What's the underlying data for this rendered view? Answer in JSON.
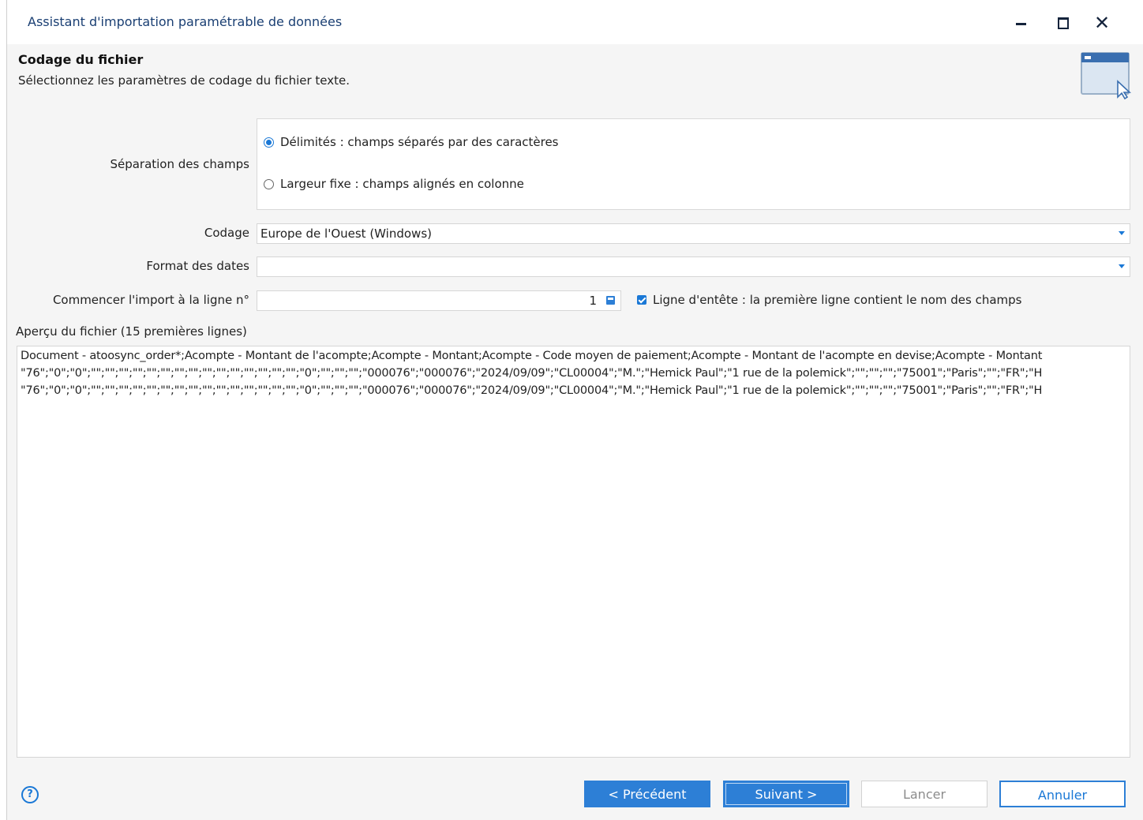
{
  "window": {
    "title": "Assistant d'importation paramétrable de données"
  },
  "header": {
    "title": "Codage du fichier",
    "description": "Sélectionnez les paramètres de codage du fichier texte."
  },
  "separation": {
    "label": "Séparation des champs",
    "options": [
      {
        "label": "Délimités : champs séparés par des caractères",
        "selected": true
      },
      {
        "label": "Largeur fixe : champs alignés en colonne",
        "selected": false
      }
    ]
  },
  "codage": {
    "label": "Codage",
    "value": "Europe de l'Ouest (Windows)"
  },
  "date_format": {
    "label": "Format des dates",
    "value": ""
  },
  "start_line": {
    "label": "Commencer l'import à la ligne n°",
    "value": "1"
  },
  "header_line": {
    "label": "Ligne d'entête : la première ligne contient le nom des champs",
    "checked": true
  },
  "preview": {
    "label": "Aperçu du fichier (15 premières lignes)",
    "lines": [
      "Document - atoosync_order*;Acompte - Montant de l'acompte;Acompte - Montant;Acompte - Code moyen de paiement;Acompte - Montant de l'acompte en devise;Acompte - Montant",
      "\"76\";\"0\";\"0\";\"\";\"\";\"\";\"\";\"\";\"\";\"\";\"\";\"\";\"\";\"\";\"\";\"\";\"\";\"\";\"0\";\"\";\"\";\"\";\"000076\";\"000076\";\"2024/09/09\";\"CL00004\";\"M.\";\"Hemick Paul\";\"1 rue de la polemick\";\"\";\"\";\"\";\"75001\";\"Paris\";\"\";\"FR\";\"H",
      "\"76\";\"0\";\"0\";\"\";\"\";\"\";\"\";\"\";\"\";\"\";\"\";\"\";\"\";\"\";\"\";\"\";\"\";\"\";\"0\";\"\";\"\";\"\";\"000076\";\"000076\";\"2024/09/09\";\"CL00004\";\"M.\";\"Hemick Paul\";\"1 rue de la polemick\";\"\";\"\";\"\";\"75001\";\"Paris\";\"\";\"FR\";\"H"
    ]
  },
  "footer": {
    "help_icon": "question-circle-icon",
    "prev_label": "< Précédent",
    "next_label": "Suivant >",
    "launch_label": "Lancer",
    "cancel_label": "Annuler"
  },
  "colors": {
    "accent": "#2d7fd6",
    "title_text": "#1a3f73"
  }
}
